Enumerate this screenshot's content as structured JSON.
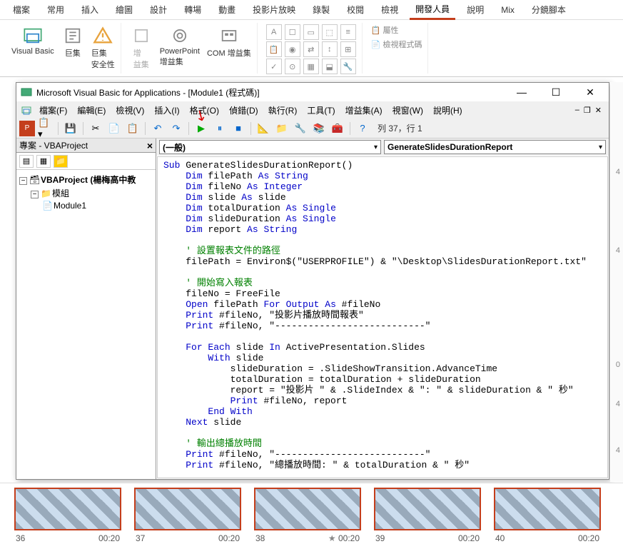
{
  "ribbon": {
    "tabs": [
      "檔案",
      "常用",
      "插入",
      "繪圖",
      "設計",
      "轉場",
      "動畫",
      "投影片放映",
      "錄製",
      "校閱",
      "檢視",
      "開發人員",
      "說明",
      "Mix",
      "分鏡腳本"
    ],
    "active_tab": "開發人員",
    "buttons": {
      "visual_basic": "Visual Basic",
      "macros": "巨集",
      "macro_security": "巨集\n安全性",
      "addins": "增\n益集",
      "ppt_addins": "PowerPoint\n增益集",
      "com_addins": "COM 增益集",
      "properties": "屬性",
      "view_code": "檢視程式碼"
    }
  },
  "vba": {
    "title": "Microsoft Visual Basic for Applications - [Module1 (程式碼)]",
    "menus": {
      "file": "檔案(F)",
      "edit": "編輯(E)",
      "view": "檢視(V)",
      "insert": "插入(I)",
      "format": "格式(O)",
      "debug": "偵錯(D)",
      "run": "執行(R)",
      "tools": "工具(T)",
      "addins": "增益集(A)",
      "window": "視窗(W)",
      "help": "說明(H)"
    },
    "toolbar_status": "列 37，行 1",
    "project": {
      "header": "專案 - VBAProject",
      "root": "VBAProject (楊梅高中教",
      "folder": "模組",
      "module": "Module1"
    },
    "dropdowns": {
      "left": "(一般)",
      "right": "GenerateSlidesDurationReport"
    }
  },
  "slides": [
    {
      "num": "36",
      "time": "00:20"
    },
    {
      "num": "37",
      "time": "00:20"
    },
    {
      "num": "38",
      "time": "00:20",
      "star": true
    },
    {
      "num": "39",
      "time": "00:20"
    },
    {
      "num": "40",
      "time": "00:20"
    }
  ],
  "right_nums": [
    "4",
    "4",
    "0",
    "4",
    "4"
  ]
}
